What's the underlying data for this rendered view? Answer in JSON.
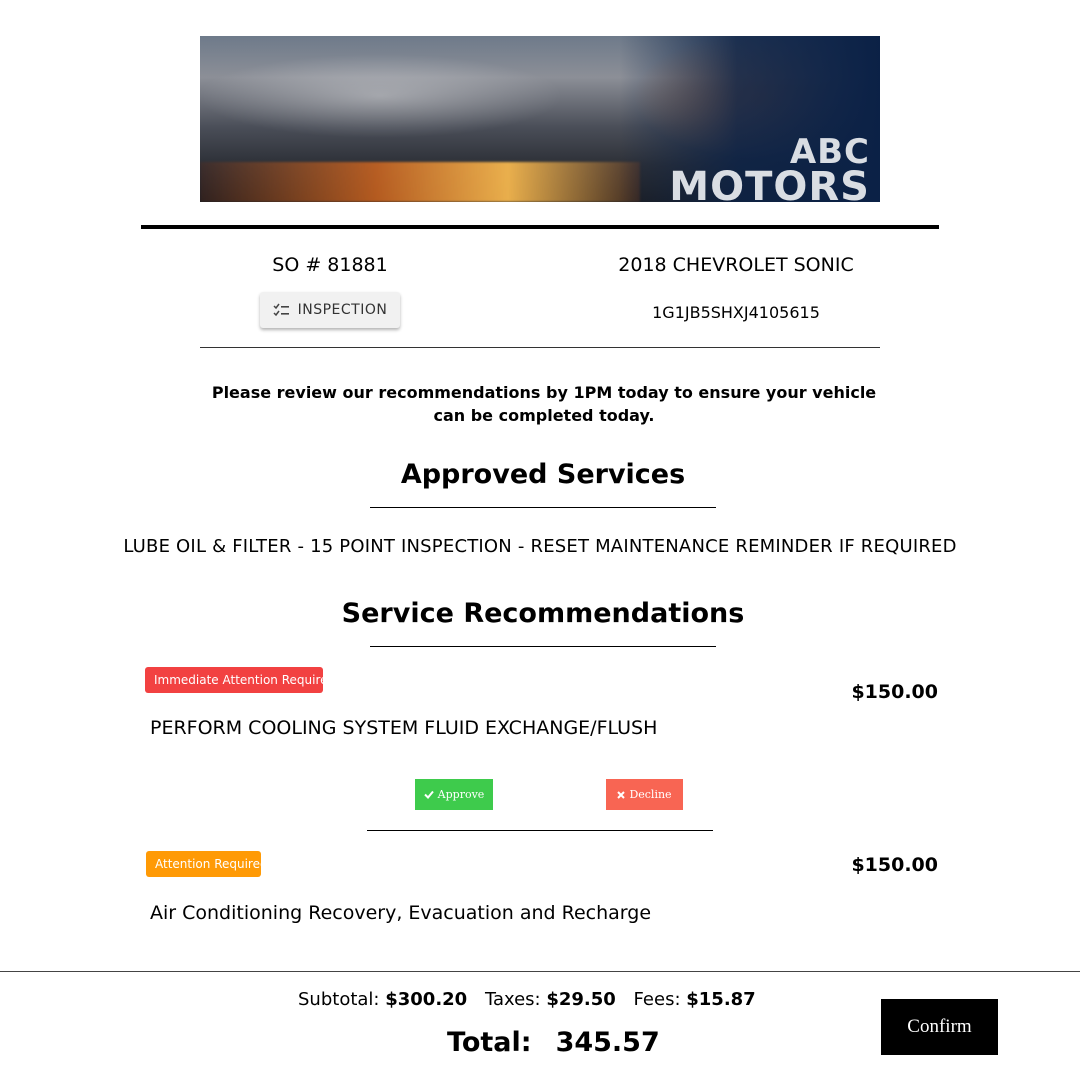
{
  "banner": {
    "logo_line1": "ABC",
    "logo_line2": "MOTORS"
  },
  "order": {
    "so_number": "SO # 81881",
    "inspection_label": "INSPECTION",
    "vehicle": "2018 CHEVROLET SONIC",
    "vin": "1G1JB5SHXJ4105615"
  },
  "notice": "Please review our recommendations by 1PM today to ensure your vehicle can be completed today.",
  "approved": {
    "title": "Approved Services",
    "services": "LUBE OIL & FILTER - 15 POINT INSPECTION - RESET MAINTENANCE REMINDER IF REQUIRED"
  },
  "recommendations": {
    "title": "Service Recommendations",
    "items": [
      {
        "badge": "Immediate Attention Required",
        "badge_color": "#f24141",
        "price": "$150.00",
        "description": "PERFORM COOLING SYSTEM FLUID EXCHANGE/FLUSH",
        "approve_label": "Approve",
        "decline_label": "Decline"
      },
      {
        "badge": "Attention Required",
        "badge_color": "#ff9a05",
        "price": "$150.00",
        "description": "Air Conditioning Recovery, Evacuation and Recharge"
      }
    ]
  },
  "totals": {
    "subtotal_label": "Subtotal:",
    "subtotal_value": "$300.20",
    "taxes_label": "Taxes:",
    "taxes_value": "$29.50",
    "fees_label": "Fees:",
    "fees_value": "$15.87",
    "total_label": "Total:",
    "total_value": "345.57"
  },
  "confirm_label": "Confirm",
  "colors": {
    "approve": "#3ecb4c",
    "decline": "#f86553",
    "confirm_bg": "#000000"
  }
}
